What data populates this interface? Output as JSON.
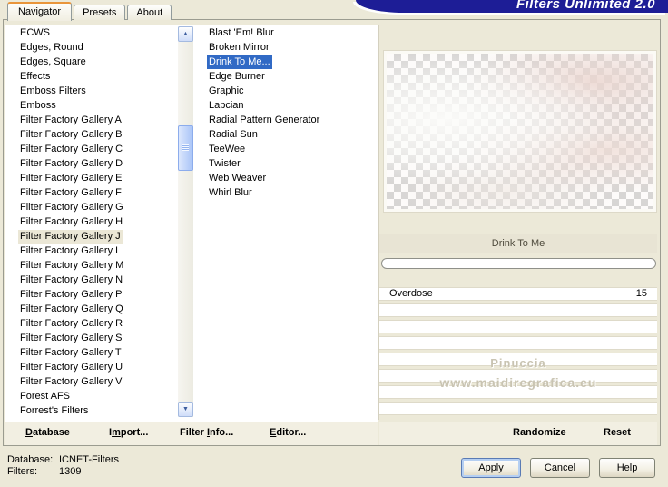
{
  "banner": {
    "title": "Filters Unlimited 2.0"
  },
  "tabs": [
    {
      "label": "Navigator",
      "state": "active"
    },
    {
      "label": "Presets"
    },
    {
      "label": "About"
    }
  ],
  "categories": {
    "items": [
      {
        "label": "ECWS"
      },
      {
        "label": "Edges, Round"
      },
      {
        "label": "Edges, Square"
      },
      {
        "label": "Effects"
      },
      {
        "label": "Emboss Filters"
      },
      {
        "label": "Emboss"
      },
      {
        "label": "Filter Factory Gallery A"
      },
      {
        "label": "Filter Factory Gallery B"
      },
      {
        "label": "Filter Factory Gallery C"
      },
      {
        "label": "Filter Factory Gallery D"
      },
      {
        "label": "Filter Factory Gallery E"
      },
      {
        "label": "Filter Factory Gallery F"
      },
      {
        "label": "Filter Factory Gallery G"
      },
      {
        "label": "Filter Factory Gallery H"
      },
      {
        "label": "Filter Factory Gallery J",
        "state": "selected"
      },
      {
        "label": "Filter Factory Gallery L"
      },
      {
        "label": "Filter Factory Gallery M"
      },
      {
        "label": "Filter Factory Gallery N"
      },
      {
        "label": "Filter Factory Gallery P"
      },
      {
        "label": "Filter Factory Gallery Q"
      },
      {
        "label": "Filter Factory Gallery R"
      },
      {
        "label": "Filter Factory Gallery S"
      },
      {
        "label": "Filter Factory Gallery T"
      },
      {
        "label": "Filter Factory Gallery U"
      },
      {
        "label": "Filter Factory Gallery V"
      },
      {
        "label": "Forest AFS"
      },
      {
        "label": "Forrest's Filters"
      }
    ]
  },
  "filters": {
    "items": [
      {
        "label": "Blast 'Em! Blur"
      },
      {
        "label": "Broken Mirror"
      },
      {
        "label": "Drink To Me...",
        "state": "selected"
      },
      {
        "label": "Edge Burner"
      },
      {
        "label": "Graphic"
      },
      {
        "label": "Lapcian"
      },
      {
        "label": "Radial Pattern Generator"
      },
      {
        "label": "Radial Sun"
      },
      {
        "label": "TeeWee"
      },
      {
        "label": "Twister"
      },
      {
        "label": "Web Weaver"
      },
      {
        "label": "Whirl Blur"
      }
    ]
  },
  "preview": {
    "caption": "Drink To Me"
  },
  "parameters": {
    "rows": [
      {
        "name": "Overdose",
        "value": "15",
        "state": "filled"
      },
      {
        "name": "",
        "value": "",
        "state": "empty"
      },
      {
        "name": "",
        "value": "",
        "state": "empty"
      },
      {
        "name": "",
        "value": "",
        "state": "empty"
      },
      {
        "name": "",
        "value": "",
        "state": "empty"
      },
      {
        "name": "",
        "value": "",
        "state": "empty"
      },
      {
        "name": "",
        "value": "",
        "state": "empty"
      },
      {
        "name": "",
        "value": "",
        "state": "empty"
      }
    ]
  },
  "watermark": {
    "line1": "Pinuccia",
    "line2": "www.maidiregrafica.eu"
  },
  "menubar": {
    "left": [
      {
        "pre": "",
        "key": "D",
        "post": "atabase"
      },
      {
        "pre": "I",
        "key": "m",
        "post": "port..."
      },
      {
        "pre": "Filter ",
        "key": "I",
        "post": "nfo..."
      },
      {
        "pre": "",
        "key": "E",
        "post": "ditor..."
      }
    ],
    "right": [
      {
        "pre": "Randomize",
        "key": "",
        "post": ""
      },
      {
        "pre": "Reset",
        "key": "",
        "post": ""
      }
    ]
  },
  "status": {
    "db_label": "Database:",
    "db_value": "ICNET-Filters",
    "filters_label": "Filters:",
    "filters_value": "1309"
  },
  "buttons": [
    {
      "label": "Apply",
      "state": "default"
    },
    {
      "label": "Cancel"
    },
    {
      "label": "Help"
    }
  ],
  "icons": {
    "scroll_up": "▲",
    "scroll_down": "▼"
  },
  "colors": {
    "dialog_bg": "#ece9d8",
    "selection_blue": "#316ac5",
    "banner_navy": "#1d1d96",
    "active_tab_accent": "#e9953a"
  }
}
